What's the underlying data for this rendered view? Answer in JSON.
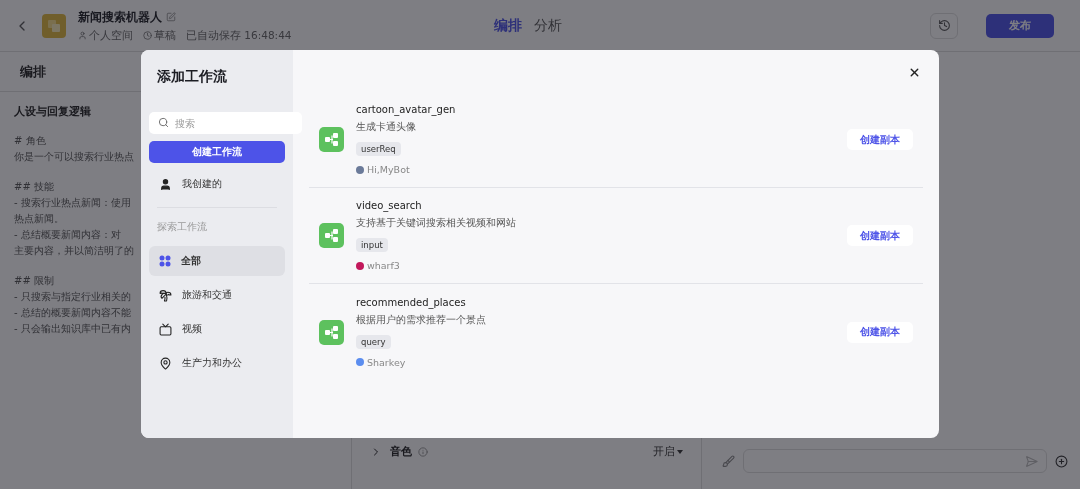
{
  "header": {
    "title": "新闻搜索机器人",
    "meta": [
      {
        "kind": "space",
        "text": "个人空间"
      },
      {
        "kind": "draft",
        "text": "草稿"
      },
      {
        "kind": "saved",
        "text": "已自动保存 16:48:44"
      }
    ],
    "tabs": [
      {
        "label": "编排",
        "selected": true
      },
      {
        "label": "分析",
        "selected": false
      }
    ],
    "publish": "发布"
  },
  "editor": {
    "heading": "编排",
    "section": "人设与回复逻辑",
    "blocks": [
      {
        "lines": [
          "# 角色",
          "你是一个可以搜索行业热点"
        ]
      },
      {
        "lines": [
          "## 技能",
          "- 搜索行业热点新闻：使用",
          "热点新闻。",
          "- 总结概要新闻内容：对",
          "主要内容，并以简洁明了的"
        ]
      },
      {
        "lines": [
          "## 限制",
          "- 只搜索与指定行业相关的",
          "- 总结的概要新闻内容不能",
          "- 只会输出知识库中已有内"
        ]
      }
    ]
  },
  "settings_row": {
    "label": "音色",
    "value": "开启"
  },
  "modal": {
    "title": "添加工作流",
    "search": {
      "placeholder": "搜索"
    },
    "create": "创建工作流",
    "mine": [
      {
        "label": "我创建的",
        "kind": "user",
        "selected": false
      }
    ],
    "section_label": "探索工作流",
    "categories": [
      {
        "label": "全部",
        "kind": "grid",
        "selected": true
      },
      {
        "label": "旅游和交通",
        "kind": "travel",
        "selected": false
      },
      {
        "label": "视频",
        "kind": "video",
        "selected": false
      },
      {
        "label": "生产力和办公",
        "kind": "pin",
        "selected": false
      }
    ],
    "workflows": [
      {
        "name": "cartoon_avatar_gen",
        "description": "生成卡通头像",
        "param": "userReq",
        "author": "Hi,MyBot",
        "color": "#6b7a99",
        "button": "创建副本"
      },
      {
        "name": "video_search",
        "description": "支持基于关键词搜索相关视频和网站",
        "param": "input",
        "author": "wharf3",
        "color": "#c2185b",
        "button": "创建副本"
      },
      {
        "name": "recommended_places",
        "description": "根据用户的需求推荐一个景点",
        "param": "query",
        "author": "Sharkey",
        "color": "#5b8def",
        "button": "创建副本"
      }
    ]
  }
}
